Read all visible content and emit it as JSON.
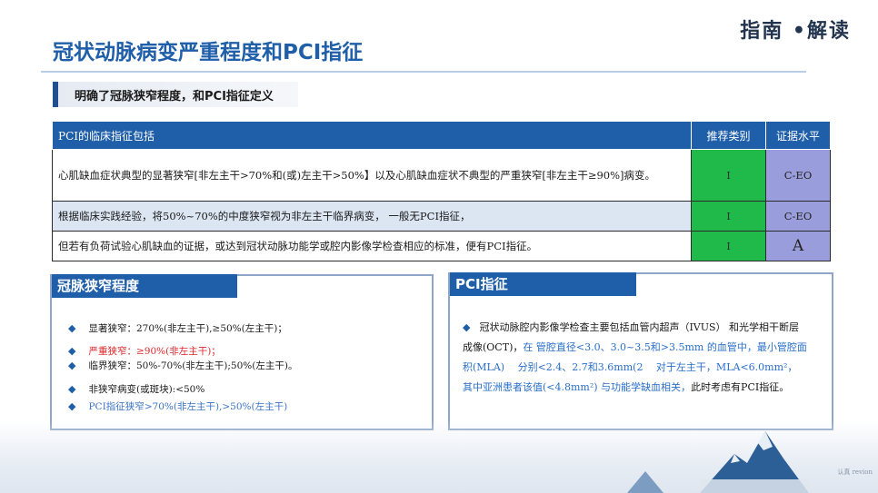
{
  "header": {
    "title": "冠状动脉病变严重程度和PCI指征",
    "brand": "指南 •解读",
    "subtitle": "明确了冠脉狭窄程度，和PCI指征定义"
  },
  "table": {
    "headers": [
      "PCI的临床指征包括",
      "推荐类别",
      "证据水平"
    ],
    "rows": [
      {
        "text": "心肌缺血症状典型的显著狭窄[非左主干>70%和(或)左主干>50%】以及心肌缺血症状不典型的严重狭窄[非左主干≥90%]病变。",
        "recommendation": "I",
        "evidence": "C-EO"
      },
      {
        "text": "根据临床实践经验，将50%~70%的中度狭窄视为非左主干临界病变， 一般无PCI指征，",
        "recommendation": "I",
        "evidence": "C-EO"
      },
      {
        "text": "但若有负荷试验心肌缺血的证据，或达到冠状动脉功能学或腔内影像学检查相应的标准，便有PCI指征。",
        "recommendation": "I",
        "evidence": "A"
      }
    ]
  },
  "left_panel": {
    "title": "冠脉狭窄程度",
    "items": [
      {
        "text": "显著狭窄：270%(非左主干),≥50%(左主干)；",
        "style": "normal"
      },
      {
        "text": "严重狭窄：≥90%(非左主干)；",
        "style": "red"
      },
      {
        "text": "临界狭窄：50%-70%(非左主干);50%(左主干)。",
        "style": "normal"
      },
      {
        "text": "非狭窄病变(或斑块):<50%",
        "style": "normal"
      },
      {
        "text": "PCI指征狭窄>70%(非左主干),>50%(左主干)",
        "style": "blue"
      }
    ]
  },
  "right_panel": {
    "title": "PCI指征",
    "p1": "冠状动脉腔内影像学检查主要包括血管内超声（IVUS） 和光学相干断层成像(OCT)，",
    "p2": "在 管腔直径<3.0、3.0~3.5和>3.5mm 的血管中，最小管腔面积(MLA)　 分别<2.4、2.7和3.6mm(2　 对于左主干，MLA<6.0mm²， 其中亚洲患者该值(<4.8mm²) 与功能学缺血相关，",
    "p3": "此时考虑有PCI指征。"
  },
  "footer": {
    "note": "认真 revion"
  },
  "colors": {
    "title_blue": "#1f5ea8",
    "rec_green": "#1fba4a",
    "evidence_purple": "#9a9ddb",
    "red_text": "#e0262a"
  }
}
